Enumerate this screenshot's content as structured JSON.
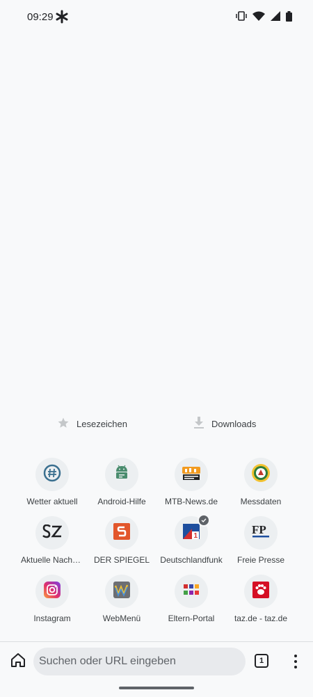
{
  "status_bar": {
    "time": "09:29"
  },
  "quick_links": {
    "bookmarks_label": "Lesezeichen",
    "downloads_label": "Downloads"
  },
  "tiles": [
    {
      "label": "Wetter aktuell",
      "icon": "globe-hash-icon"
    },
    {
      "label": "Android-Hilfe",
      "icon": "android-icon"
    },
    {
      "label": "MTB-News.de",
      "icon": "mtb-news-icon"
    },
    {
      "label": "Messdaten",
      "icon": "emblem-icon"
    },
    {
      "label": "Aktuelle Nachrichten",
      "icon": "sz-icon"
    },
    {
      "label": "DER SPIEGEL",
      "icon": "spiegel-icon"
    },
    {
      "label": "Deutschlandfunk",
      "icon": "deutschlandfunk-icon"
    },
    {
      "label": "Freie Presse",
      "icon": "fp-icon"
    },
    {
      "label": "Instagram",
      "icon": "instagram-icon"
    },
    {
      "label": "WebMenü",
      "icon": "webmenu-icon"
    },
    {
      "label": "Eltern-Portal",
      "icon": "grid-icon"
    },
    {
      "label": "taz.de - taz.de",
      "icon": "taz-icon"
    }
  ],
  "toolbar": {
    "search_placeholder": "Suchen oder URL eingeben",
    "tab_count": "1"
  },
  "colors": {
    "background": "#f8f9fa",
    "tile_bg": "#eceff1",
    "omnibox_bg": "#e8eaed"
  }
}
